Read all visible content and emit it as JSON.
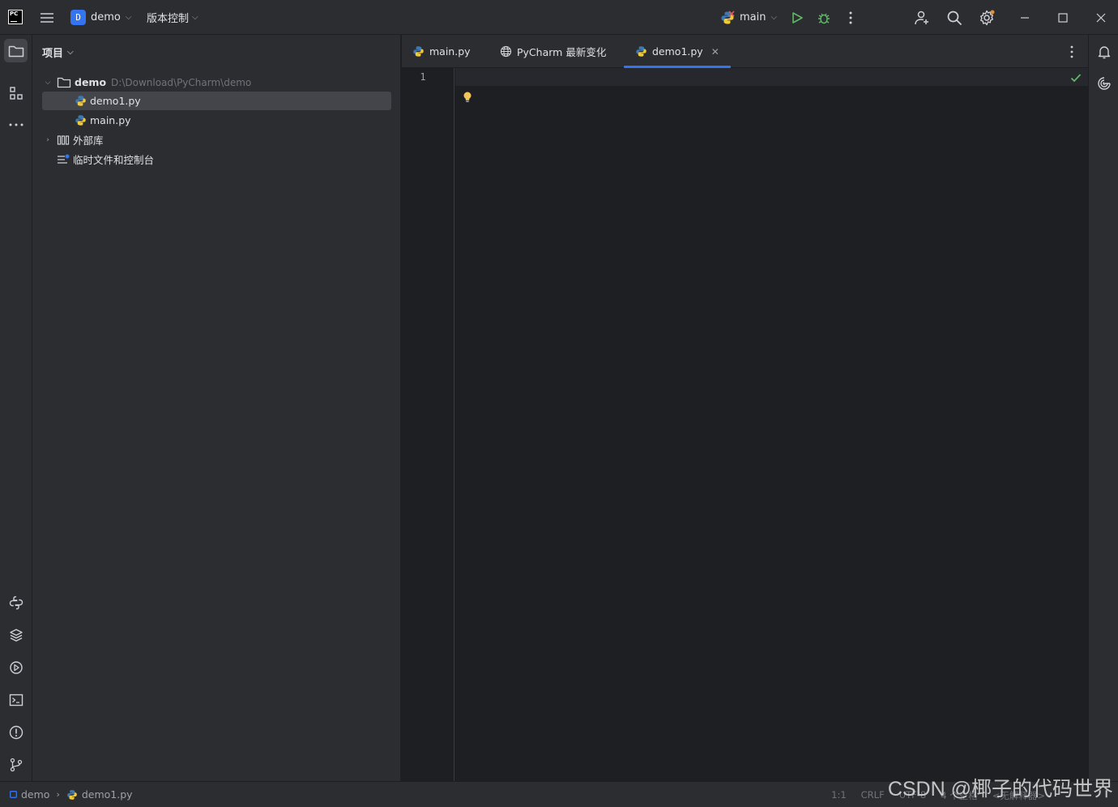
{
  "titlebar": {
    "app_logo_text": "PC",
    "project_badge": "D",
    "project_name": "demo",
    "vcs_label": "版本控制",
    "run_config": "main"
  },
  "project_panel": {
    "title": "项目",
    "root": {
      "name": "demo",
      "path": "D:\\Download\\PyCharm\\demo"
    },
    "files": [
      {
        "name": "demo1.py",
        "selected": true
      },
      {
        "name": "main.py",
        "selected": false
      }
    ],
    "external_libs": "外部库",
    "scratches": "临时文件和控制台"
  },
  "tabs": [
    {
      "label": "main.py",
      "icon": "python-file-icon",
      "active": false
    },
    {
      "label": "PyCharm 最新变化",
      "icon": "globe-icon",
      "active": false
    },
    {
      "label": "demo1.py",
      "icon": "python-file-icon",
      "active": true
    }
  ],
  "editor": {
    "line_numbers": [
      "1"
    ]
  },
  "statusbar": {
    "breadcrumb_project": "demo",
    "breadcrumb_file": "demo1.py",
    "right_items": [
      "1:1",
      "CRLF",
      "UTF-8",
      "4 个空格",
      "<无解释器>"
    ]
  },
  "watermark": "CSDN @椰子的代码世界",
  "colors": {
    "accent": "#3574f0",
    "run": "#5fb865",
    "bg_editor": "#1e1f22",
    "bg_panel": "#2b2d30",
    "bulb": "#f2c55c"
  }
}
